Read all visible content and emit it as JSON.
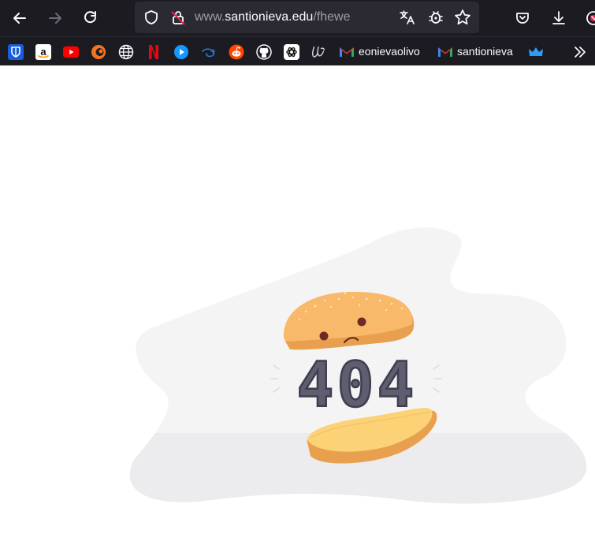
{
  "window": {
    "url_prefix": "www.",
    "url_host": "santionieva.edu",
    "url_path": "/fhewe"
  },
  "toolbar": {
    "back_icon": "arrow-left-icon",
    "forward_icon": "arrow-right-icon",
    "reload_icon": "reload-icon",
    "tracking_icon": "shield-icon",
    "insecure_icon": "insecure-lock-icon",
    "translate_icon": "translate-icon",
    "extension_icon": "bug-icon",
    "bookmark_icon": "star-icon",
    "pocket_icon": "pocket-icon",
    "downloads_icon": "download-icon",
    "profile_icon": "blocked-badge-icon"
  },
  "bookmarks": {
    "items": [
      {
        "icon": "bitwarden-icon"
      },
      {
        "icon": "amazon-icon"
      },
      {
        "icon": "youtube-icon"
      },
      {
        "icon": "crunchyroll-icon"
      },
      {
        "icon": "globe-icon"
      },
      {
        "icon": "netflix-icon"
      },
      {
        "icon": "prime-video-icon"
      },
      {
        "icon": "disney-plus-icon"
      },
      {
        "icon": "reddit-icon"
      },
      {
        "icon": "github-icon"
      },
      {
        "icon": "openai-icon"
      },
      {
        "icon": "script-logo-icon"
      }
    ],
    "gmail_1": "eonievaolivo",
    "gmail_2": "santionieva",
    "crown_icon": "crown-icon",
    "overflow_icon": "double-chevron-icon"
  },
  "page": {
    "error_code": "404",
    "colors": {
      "bun": "#f9b96b",
      "bun_dark": "#e9a04e",
      "number": "#5f5e70",
      "blob": "#f4f4f5",
      "floor": "#ececee"
    }
  }
}
